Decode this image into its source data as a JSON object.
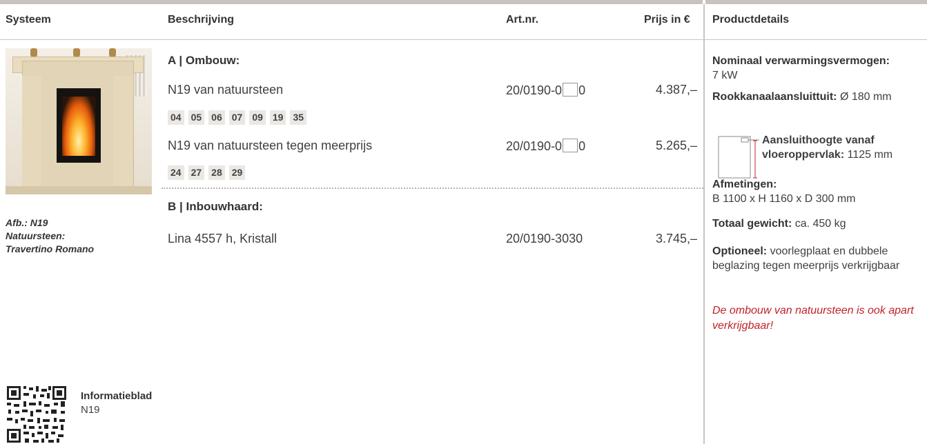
{
  "header": {
    "systeem": "Systeem",
    "beschrijving": "Beschrijving",
    "artnr": "Art.nr.",
    "prijs": "Prijs in €",
    "productdetails": "Productdetails"
  },
  "photo_caption": [
    "Afb.: N19",
    "Natuursteen:",
    "Travertino Romano"
  ],
  "section_a": {
    "title": "A | Ombouw:",
    "rows": [
      {
        "desc": "N19 van natuursteen",
        "art_prefix": "20/0190-0",
        "art_suffix": "0",
        "price": "4.387,–"
      },
      {
        "desc": "N19 van natuursteen tegen meerprijs",
        "art_prefix": "20/0190-0",
        "art_suffix": "0",
        "price": "5.265,–"
      }
    ],
    "codes_1": [
      "04",
      "05",
      "06",
      "07",
      "09",
      "19",
      "35"
    ],
    "codes_2": [
      "24",
      "27",
      "28",
      "29"
    ]
  },
  "section_b": {
    "title": "B | Inbouwhaard:",
    "row": {
      "desc": "Lina 4557 h, Kristall",
      "art": "20/0190-3030",
      "price": "3.745,–"
    }
  },
  "info": {
    "title": "Informatieblad",
    "sub": "N19"
  },
  "details": {
    "power_label": "Nominaal verwarmingsvermogen:",
    "power_value": "7 kW",
    "flue_label": "Rookkanaalaansluittuit:",
    "flue_value": "Ø 180 mm",
    "height_label": "Aansluithoogte vanaf vloeroppervlak:",
    "height_value": "1125 mm",
    "dim_label": "Afmetingen:",
    "dim_value": "B 1100 x H 1160 x D 300 mm",
    "weight_label": "Totaal gewicht:",
    "weight_value": "ca. 450 kg",
    "optional_label": "Optioneel:",
    "optional_value": "voorlegplaat en dubbele beglazing tegen meerprijs verkrijgbaar",
    "note": "De ombouw van natuursteen is ook apart verkrijgbaar!"
  },
  "colors": {
    "rule": "#c9c3bf",
    "note": "#c0202a",
    "badge": "#ebe7e3"
  }
}
